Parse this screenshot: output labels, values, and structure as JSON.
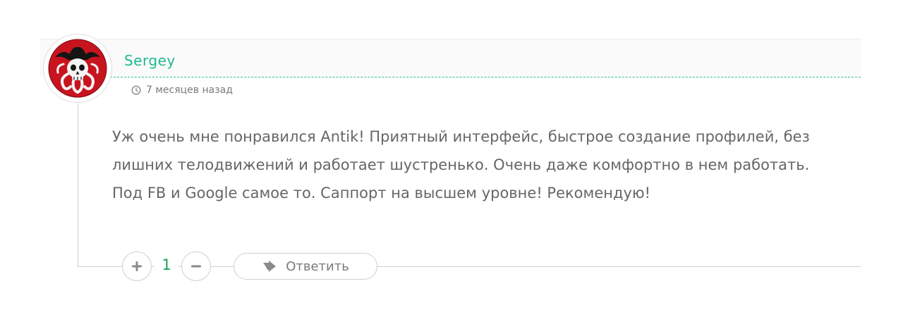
{
  "comment": {
    "author": "Sergey",
    "time": "7 месяцев назад",
    "text": "Уж очень мне понравился Antik! Приятный интерфейс, быстрое создание профилей, без лишних телодвижений и работает шустренько. Очень даже комфортно в нем работать. Под FB и Google самое то. Саппорт на высшем уровне! Рекомендую!",
    "avatar_icon": "skull-emblem-icon"
  },
  "actions": {
    "vote_up_icon": "plus-icon",
    "vote_down_icon": "minus-icon",
    "vote_count": "1",
    "reply_label": "Ответить",
    "reply_icon": "reply-arrow-icon"
  },
  "colors": {
    "author": "#1fb88e",
    "vote_count": "#1aa05a",
    "text": "#666666",
    "avatar_red": "#c8141e"
  }
}
